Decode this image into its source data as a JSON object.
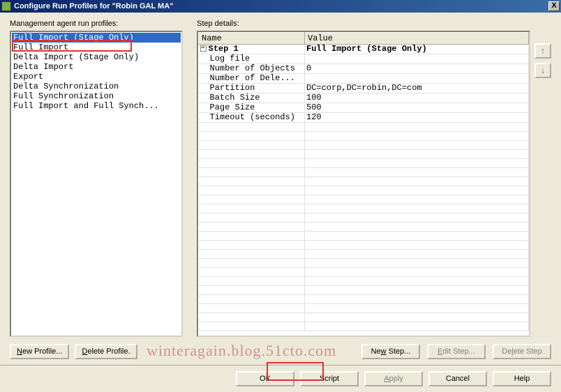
{
  "window": {
    "title": "Configure Run Profiles for \"Robin GAL MA\"",
    "close": "X"
  },
  "labels": {
    "left_header": "Management agent run profiles:",
    "right_header": "Step details:"
  },
  "profiles": [
    "Full Import (Stage Only)",
    "Full Import",
    "Delta Import (Stage Only)",
    "Delta Import",
    "Export",
    "Delta Synchronization",
    "Full Synchronization",
    "Full Import and Full Synch..."
  ],
  "grid": {
    "headers": [
      "Name",
      "Value"
    ],
    "step_name": "Step 1",
    "step_value": "Full Import (Stage Only)",
    "rows": [
      {
        "name": "Log file",
        "value": ""
      },
      {
        "name": "Number of Objects",
        "value": "0"
      },
      {
        "name": "Number of Dele...",
        "value": ""
      },
      {
        "name": "Partition",
        "value": "DC=corp,DC=robin,DC=com"
      },
      {
        "name": "Batch Size",
        "value": "100"
      },
      {
        "name": "Page Size",
        "value": "500"
      },
      {
        "name": "Timeout (seconds)",
        "value": "120"
      }
    ]
  },
  "buttons": {
    "new_profile": "New Profile...",
    "delete_profile": "Delete Profile.",
    "new_step": "New Step...",
    "edit_step": "Edit Step...",
    "delete_step": "Delete Step",
    "ok": "OK",
    "script": "Script",
    "apply": "Apply",
    "cancel": "Cancel",
    "help": "Help",
    "up": "↑",
    "down": "↓"
  },
  "watermark": "winteragain.blog.51cto.com"
}
